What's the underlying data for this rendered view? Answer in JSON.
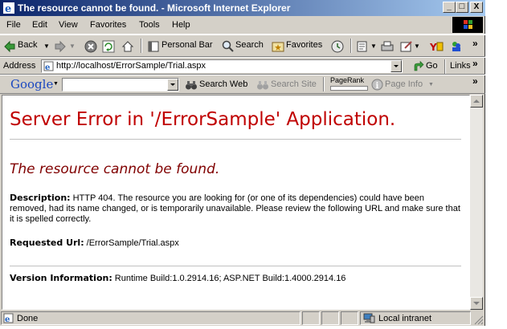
{
  "window": {
    "title": "The resource cannot be found. - Microsoft Internet Explorer",
    "minimize": "_",
    "maximize": "□",
    "close": "X"
  },
  "menu": [
    "File",
    "Edit",
    "View",
    "Favorites",
    "Tools",
    "Help"
  ],
  "toolbar": {
    "back": "Back",
    "personal_bar": "Personal Bar",
    "search": "Search",
    "favorites": "Favorites"
  },
  "address": {
    "label": "Address",
    "url": "http://localhost/ErrorSample/Trial.aspx",
    "go": "Go",
    "links": "Links",
    "chevron": "»"
  },
  "google": {
    "logo": "Google",
    "search_value": "",
    "search_web": "Search Web",
    "search_site": "Search Site",
    "pagerank": "PageRank",
    "page_info": "Page Info",
    "chevron": "»"
  },
  "page": {
    "heading": "Server Error in '/ErrorSample' Application.",
    "subheading": "The resource cannot be found.",
    "description_label": "Description:",
    "description_text": "HTTP 404. The resource you are looking for (or one of its dependencies) could have been removed, had its name changed, or is temporarily unavailable. Please review the following URL and make sure that it is spelled correctly.",
    "requested_url_label": "Requested Url:",
    "requested_url": "/ErrorSample/Trial.aspx",
    "version_label": "Version Information:",
    "version_text": "Runtime Build:1.0.2914.16; ASP.NET Build:1.4000.2914.16"
  },
  "status": {
    "text": "Done",
    "zone": "Local intranet"
  },
  "colors": {
    "title_start": "#0a246a",
    "title_end": "#a6caf0",
    "error_heading": "#c00000",
    "error_subheading": "#800000"
  }
}
